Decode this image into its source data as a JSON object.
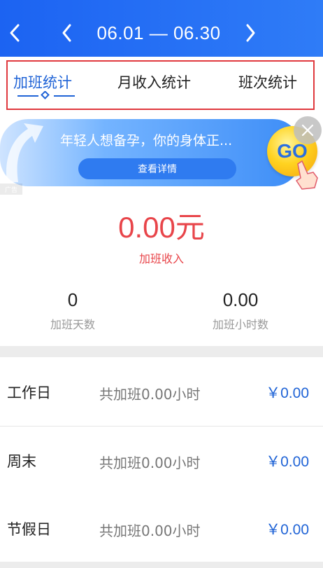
{
  "header": {
    "date_range": "06.01 — 06.30"
  },
  "tabs": [
    {
      "label": "加班统计",
      "active": true
    },
    {
      "label": "月收入统计",
      "active": false
    },
    {
      "label": "班次统计",
      "active": false
    }
  ],
  "ad": {
    "title": "年轻人想备孕，你的身体正...",
    "button": "查看详情",
    "badge_text": "GO",
    "tag": "广告"
  },
  "income": {
    "value": "0.00元",
    "label": "加班收入"
  },
  "stats": [
    {
      "value": "0",
      "label": "加班天数"
    },
    {
      "value": "0.00",
      "label": "加班小时数"
    }
  ],
  "rows": [
    {
      "label": "工作日",
      "detail": "共加班0.00小时",
      "amount": "￥0.00"
    },
    {
      "label": "周末",
      "detail": "共加班0.00小时",
      "amount": "￥0.00"
    },
    {
      "label": "节假日",
      "detail": "共加班0.00小时",
      "amount": "￥0.00"
    }
  ],
  "colors": {
    "header_blue": "#1c63f2",
    "accent_blue": "#1f63d6",
    "income_red": "#e8454a",
    "highlight_border": "#e0393e"
  }
}
